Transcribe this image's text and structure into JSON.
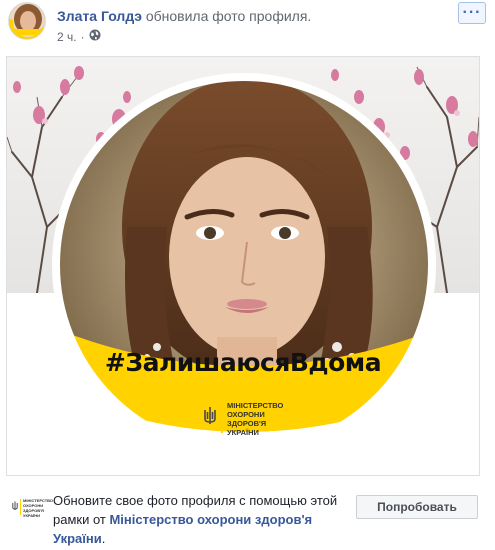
{
  "post": {
    "author_name": "Злата Голдэ",
    "action_text": "обновила фото профиля.",
    "time": "2 ч.",
    "separator": "·",
    "privacy_icon": "globe-icon",
    "more_icon": "ellipsis-icon",
    "more_label": "···"
  },
  "frame": {
    "hashtag": "#ЗалишаюсяВдома",
    "ministry_line1": "МІНІСТЕРСТВО",
    "ministry_line2": "ОХОРОНИ",
    "ministry_line3": "ЗДОРОВ'Я",
    "ministry_line4": "УКРАЇНИ",
    "accent_color": "#ffd200",
    "emblem_icon": "trident-icon"
  },
  "promo": {
    "text": "Обновите свое фото профиля с помощью этой рамки от ",
    "link": "Міністерство охорони здоров'я України",
    "end": ".",
    "button_label": "Попробовать",
    "logo_line1": "МІНІСТЕРСТВО",
    "logo_line2": "ОХОРОНИ",
    "logo_line3": "ЗДОРОВ'Я",
    "logo_line4": "УКРАЇНИ"
  }
}
